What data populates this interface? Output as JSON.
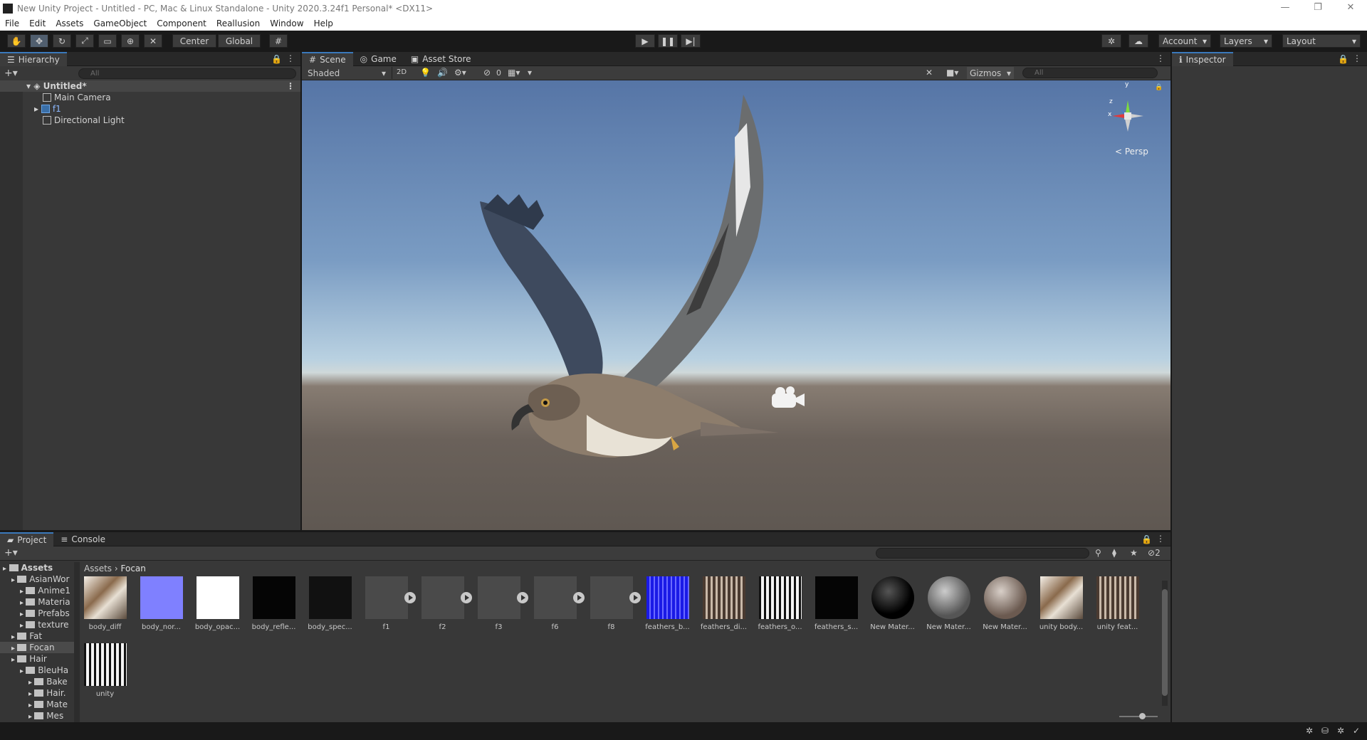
{
  "window": {
    "title": "New Unity Project - Untitled - PC, Mac & Linux Standalone - Unity 2020.3.24f1 Personal* <DX11>",
    "controls": [
      "—",
      "❐",
      "✕"
    ]
  },
  "menu": [
    "File",
    "Edit",
    "Assets",
    "GameObject",
    "Component",
    "Reallusion",
    "Window",
    "Help"
  ],
  "toolbar": {
    "pivot": "Center",
    "space": "Global",
    "account": "Account",
    "layers": "Layers",
    "layout": "Layout"
  },
  "hierarchy": {
    "tab": "Hierarchy",
    "search_placeholder": "All",
    "scene": "Untitled*",
    "items": [
      "Main Camera",
      "f1",
      "Directional Light"
    ]
  },
  "scene_view": {
    "tabs": [
      "Scene",
      "Game",
      "Asset Store"
    ],
    "shading": "Shaded",
    "mode_2d": "2D",
    "hidden_count": "0",
    "gizmos": "Gizmos",
    "search_placeholder": "All",
    "persp": "< Persp",
    "axes": {
      "y": "y",
      "z": "z",
      "x": "x"
    }
  },
  "inspector": {
    "tab": "Inspector"
  },
  "project": {
    "tabs": [
      "Project",
      "Console"
    ],
    "breadcrumb": [
      "Assets",
      "Focan"
    ],
    "hidden_count": "2",
    "tree": [
      {
        "label": "Assets",
        "depth": 0,
        "bold": true
      },
      {
        "label": "AsianWor",
        "depth": 1
      },
      {
        "label": "Anime1",
        "depth": 2
      },
      {
        "label": "Materia",
        "depth": 2
      },
      {
        "label": "Prefabs",
        "depth": 2
      },
      {
        "label": "texture",
        "depth": 2
      },
      {
        "label": "Fat",
        "depth": 1
      },
      {
        "label": "Focan",
        "depth": 1,
        "selected": true
      },
      {
        "label": "Hair",
        "depth": 1
      },
      {
        "label": "BleuHa",
        "depth": 2
      },
      {
        "label": "Bake",
        "depth": 3
      },
      {
        "label": "Hair.",
        "depth": 3
      },
      {
        "label": "Mate",
        "depth": 3
      },
      {
        "label": "Mes",
        "depth": 3
      }
    ],
    "assets": [
      {
        "label": "body_diff",
        "kind": "tex-bird"
      },
      {
        "label": "body_nor...",
        "kind": "tex-normal"
      },
      {
        "label": "body_opac...",
        "kind": "tex-white"
      },
      {
        "label": "body_refle...",
        "kind": "tex-black"
      },
      {
        "label": "body_spec...",
        "kind": "tex-dark"
      },
      {
        "label": "f1",
        "kind": "anim"
      },
      {
        "label": "f2",
        "kind": "anim"
      },
      {
        "label": "f3",
        "kind": "anim"
      },
      {
        "label": "f6",
        "kind": "anim"
      },
      {
        "label": "f8",
        "kind": "anim"
      },
      {
        "label": "feathers_b...",
        "kind": "tex-blue"
      },
      {
        "label": "feathers_di...",
        "kind": "tex-feather"
      },
      {
        "label": "feathers_o...",
        "kind": "tex-feather-bw"
      },
      {
        "label": "feathers_s...",
        "kind": "tex-black"
      },
      {
        "label": "New Mater...",
        "kind": "mat-black"
      },
      {
        "label": "New Mater...",
        "kind": "mat-grey"
      },
      {
        "label": "New Mater...",
        "kind": "mat-brown"
      },
      {
        "label": "unity body...",
        "kind": "tex-bird"
      },
      {
        "label": "unity feat...",
        "kind": "tex-feather"
      },
      {
        "label": "unity",
        "kind": "tex-feather-bw"
      }
    ]
  }
}
